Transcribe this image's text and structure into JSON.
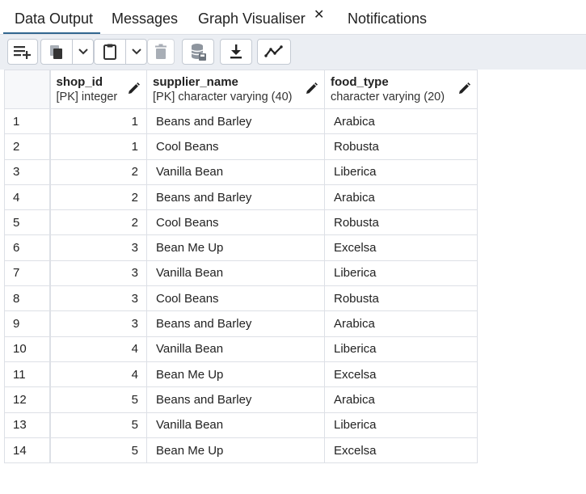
{
  "tabs": {
    "data_output": "Data Output",
    "messages": "Messages",
    "graph_visualiser": "Graph Visualiser",
    "close_glyph": "✕",
    "notifications": "Notifications"
  },
  "colors": {
    "accent": "#326690",
    "toolbar_bg": "#ebeef3",
    "grid_border": "#dde0e6"
  },
  "toolbar": {
    "icons": [
      "add-row-icon",
      "copy-icon",
      "chevron-down-icon",
      "paste-icon",
      "chevron-down-icon",
      "delete-icon",
      "save-data-icon",
      "download-icon",
      "graph-icon"
    ]
  },
  "grid": {
    "columns": [
      {
        "name": "shop_id",
        "type": "[PK] integer"
      },
      {
        "name": "supplier_name",
        "type": "[PK] character varying (40)"
      },
      {
        "name": "food_type",
        "type": "character varying (20)"
      }
    ],
    "rows": [
      {
        "n": "1",
        "shop_id": "1",
        "supplier_name": "Beans and Barley",
        "food_type": "Arabica"
      },
      {
        "n": "2",
        "shop_id": "1",
        "supplier_name": "Cool Beans",
        "food_type": "Robusta"
      },
      {
        "n": "3",
        "shop_id": "2",
        "supplier_name": "Vanilla Bean",
        "food_type": "Liberica"
      },
      {
        "n": "4",
        "shop_id": "2",
        "supplier_name": "Beans and Barley",
        "food_type": "Arabica"
      },
      {
        "n": "5",
        "shop_id": "2",
        "supplier_name": "Cool Beans",
        "food_type": "Robusta"
      },
      {
        "n": "6",
        "shop_id": "3",
        "supplier_name": "Bean Me Up",
        "food_type": "Excelsa"
      },
      {
        "n": "7",
        "shop_id": "3",
        "supplier_name": "Vanilla Bean",
        "food_type": "Liberica"
      },
      {
        "n": "8",
        "shop_id": "3",
        "supplier_name": "Cool Beans",
        "food_type": "Robusta"
      },
      {
        "n": "9",
        "shop_id": "3",
        "supplier_name": "Beans and Barley",
        "food_type": "Arabica"
      },
      {
        "n": "10",
        "shop_id": "4",
        "supplier_name": "Vanilla Bean",
        "food_type": "Liberica"
      },
      {
        "n": "11",
        "shop_id": "4",
        "supplier_name": "Bean Me Up",
        "food_type": "Excelsa"
      },
      {
        "n": "12",
        "shop_id": "5",
        "supplier_name": "Beans and Barley",
        "food_type": "Arabica"
      },
      {
        "n": "13",
        "shop_id": "5",
        "supplier_name": "Vanilla Bean",
        "food_type": "Liberica"
      },
      {
        "n": "14",
        "shop_id": "5",
        "supplier_name": "Bean Me Up",
        "food_type": "Excelsa"
      }
    ]
  }
}
